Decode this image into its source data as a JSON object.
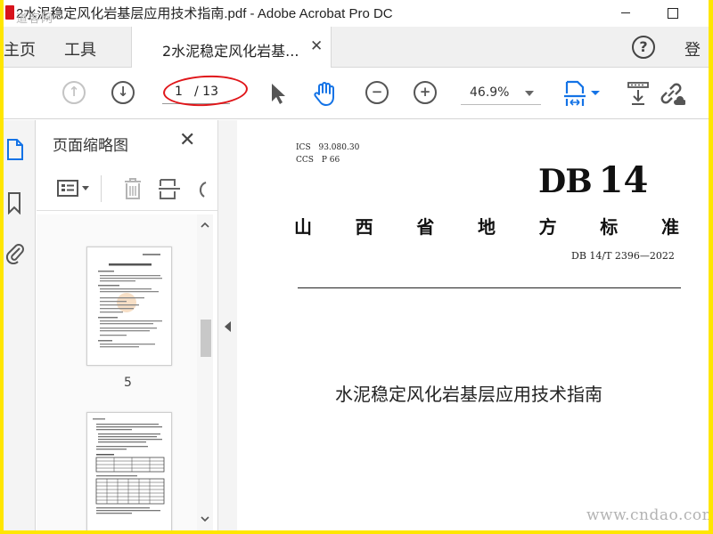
{
  "window": {
    "title": "2水泥稳定风化岩基层应用技术指南.pdf - Adobe Acrobat Pro DC",
    "watermark_top": "道客网"
  },
  "tabs": {
    "home": "主页",
    "tools": "工具",
    "document_tab": "2水泥稳定风化岩基...",
    "document_tab_close": "✕",
    "help": "?",
    "login": "登"
  },
  "toolbar": {
    "prev_page": "↑",
    "next_page": "↓",
    "page_current": "1",
    "page_total": "/ 13",
    "zoom_out": "−",
    "zoom_in": "+",
    "zoom_value": "46.9%"
  },
  "sidebar": {
    "panel_title": "页面缩略图",
    "panel_close": "✕",
    "thumbnails": [
      {
        "label": "5"
      },
      {
        "label": ""
      }
    ]
  },
  "document": {
    "ics_label": "ICS",
    "ics_value": "93.080.30",
    "ccs_label": "CCS",
    "ccs_value": "P 66",
    "db_prefix": "DB",
    "db_number": "14",
    "standard_chars": [
      "山",
      "西",
      "省",
      "地",
      "方",
      "标",
      "准"
    ],
    "standard_code": "DB 14/T 2396—2022",
    "title": "水泥稳定风化岩基层应用技术指南"
  },
  "watermark_bottom": "www.cndao.com",
  "colors": {
    "acrobat_blue": "#1473e6",
    "annotation_red": "#e0161a",
    "frame_yellow": "#ffe600"
  }
}
